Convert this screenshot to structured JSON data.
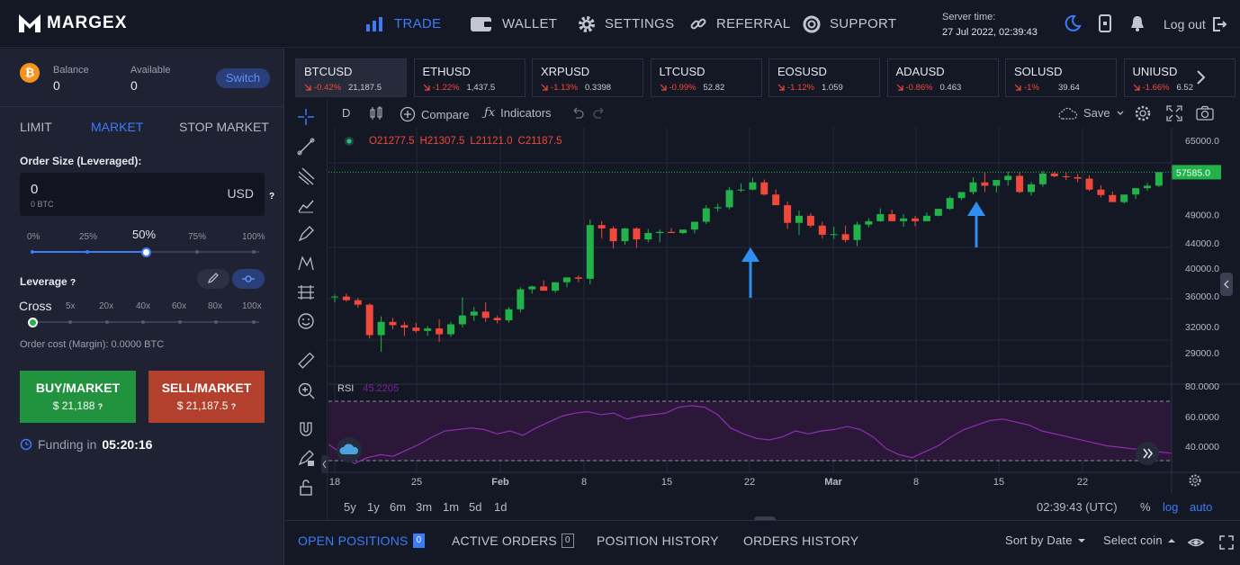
{
  "brand": {
    "name": "MARGEX"
  },
  "nav": {
    "trade": "TRADE",
    "wallet": "WALLET",
    "settings": "SETTINGS",
    "referral": "REFERRAL",
    "support": "SUPPORT"
  },
  "server": {
    "label": "Server time:",
    "time": "27 Jul 2022, 02:39:43"
  },
  "logout": "Log out",
  "account": {
    "coin_symbol": "₿",
    "balance_label": "Balance",
    "balance": "0",
    "available_label": "Available",
    "available": "0",
    "switch_label": "Switch"
  },
  "order_tabs": [
    "LIMIT",
    "MARKET",
    "STOP MARKET"
  ],
  "order_size": {
    "label": "Order Size (Leveraged):",
    "value": "0",
    "sub": "0 BTC",
    "currency": "USD",
    "help": "?"
  },
  "size_slider": {
    "ticks": [
      "0%",
      "25%",
      "50%",
      "75%",
      "100%"
    ],
    "value_pct": 50
  },
  "leverage": {
    "label": "Leverage",
    "help": "?",
    "mode": "Cross",
    "ticks": [
      "5x",
      "20x",
      "40x",
      "60x",
      "80x",
      "100x"
    ],
    "selected": "Cross"
  },
  "order_cost": "Order cost (Margin): 0.0000 BTC",
  "buy": {
    "label": "BUY/MARKET",
    "price": "$ 21,188",
    "help": "?"
  },
  "sell": {
    "label": "SELL/MARKET",
    "price": "$ 21,187.5",
    "help": "?"
  },
  "funding": {
    "label": "Funding in",
    "value": "05:20:16"
  },
  "tickers": [
    {
      "symbol": "BTCUSD",
      "change": "-0.42%",
      "price": "21,187.5"
    },
    {
      "symbol": "ETHUSD",
      "change": "-1.22%",
      "price": "1,437.5"
    },
    {
      "symbol": "XRPUSD",
      "change": "-1.13%",
      "price": "0.3398"
    },
    {
      "symbol": "LTCUSD",
      "change": "-0.99%",
      "price": "52.82"
    },
    {
      "symbol": "EOSUSD",
      "change": "-1.12%",
      "price": "1.059"
    },
    {
      "symbol": "ADAUSD",
      "change": "-0.86%",
      "price": "0.463"
    },
    {
      "symbol": "SOLUSD",
      "change": "-1%",
      "price": "39.64"
    },
    {
      "symbol": "UNIUSD",
      "change": "-1.66%",
      "price": "6.52"
    }
  ],
  "toolbar": {
    "interval": "D",
    "compare": "Compare",
    "indicators": "Indicators",
    "save": "Save"
  },
  "ohlc": {
    "o": "O21277.5",
    "h": "H21307.5",
    "l": "L21121.0",
    "c": "C21187.5"
  },
  "chart_data": {
    "type": "candlestick",
    "price_axis": [
      "65000.0",
      "57585.0",
      "49000.0",
      "44000.0",
      "40000.0",
      "36000.0",
      "32000.0",
      "29000.0"
    ],
    "current_price": "57585.0",
    "x_ticks": [
      "18",
      "25",
      "Feb",
      "8",
      "15",
      "22",
      "Mar",
      "8",
      "15",
      "22"
    ],
    "rsi_axis": [
      "80.0000",
      "60.0000",
      "40.0000"
    ],
    "rsi_label": "RSI",
    "rsi_value": "45.2205",
    "candles": [
      [
        35800,
        36200,
        35100,
        35900
      ],
      [
        35900,
        36300,
        35200,
        35400
      ],
      [
        35400,
        35700,
        34400,
        34800
      ],
      [
        34800,
        35000,
        30600,
        31000
      ],
      [
        31000,
        33300,
        29100,
        32600
      ],
      [
        32600,
        33100,
        31700,
        32200
      ],
      [
        32200,
        32600,
        30900,
        31900
      ],
      [
        31900,
        32500,
        31300,
        31500
      ],
      [
        31500,
        32100,
        30900,
        31800
      ],
      [
        31800,
        32900,
        30200,
        31100
      ],
      [
        31100,
        32600,
        30800,
        32300
      ],
      [
        32300,
        35800,
        31900,
        33400
      ],
      [
        33400,
        34500,
        32700,
        33900
      ],
      [
        33900,
        35100,
        32600,
        33100
      ],
      [
        33100,
        33400,
        32400,
        32800
      ],
      [
        32800,
        34500,
        32500,
        34200
      ],
      [
        34200,
        37200,
        33800,
        36900
      ],
      [
        36900,
        37400,
        36300,
        37300
      ],
      [
        37300,
        38200,
        36800,
        36700
      ],
      [
        36700,
        37900,
        36400,
        37900
      ],
      [
        37900,
        38600,
        37200,
        38600
      ],
      [
        38600,
        38900,
        37900,
        38400
      ],
      [
        38400,
        48100,
        37600,
        47100
      ],
      [
        47100,
        47800,
        44800,
        46500
      ],
      [
        46500,
        46900,
        43100,
        44300
      ],
      [
        44300,
        46600,
        43700,
        46500
      ],
      [
        46500,
        46700,
        43200,
        44600
      ],
      [
        44600,
        46400,
        44100,
        45700
      ],
      [
        45700,
        46300,
        44100,
        45900
      ],
      [
        45900,
        46600,
        45700,
        45700
      ],
      [
        45700,
        46300,
        45500,
        46300
      ],
      [
        46300,
        47300,
        45600,
        47700
      ],
      [
        47700,
        50800,
        47300,
        50200
      ],
      [
        50200,
        51100,
        49600,
        50400
      ],
      [
        50400,
        54400,
        50000,
        53800
      ],
      [
        53800,
        55200,
        53400,
        53900
      ],
      [
        53900,
        56400,
        53700,
        55400
      ],
      [
        55400,
        56000,
        52700,
        52900
      ],
      [
        52900,
        53900,
        50900,
        50800
      ],
      [
        50800,
        51500,
        46400,
        47500
      ],
      [
        47500,
        49800,
        45400,
        48800
      ],
      [
        48800,
        49300,
        46700,
        47000
      ],
      [
        47000,
        47700,
        44800,
        45400
      ],
      [
        45400,
        46800,
        44700,
        45500
      ],
      [
        45500,
        47000,
        44100,
        44500
      ],
      [
        44500,
        47700,
        43500,
        47200
      ],
      [
        47200,
        48300,
        46700,
        47800
      ],
      [
        47800,
        50200,
        47700,
        49100
      ],
      [
        49100,
        49900,
        47800,
        47800
      ],
      [
        47800,
        49100,
        46800,
        48300
      ],
      [
        48300,
        48800,
        46900,
        47800
      ],
      [
        47800,
        49400,
        47800,
        48800
      ],
      [
        48800,
        50000,
        48700,
        50100
      ],
      [
        50100,
        52600,
        49900,
        52200
      ],
      [
        52200,
        53300,
        51800,
        53400
      ],
      [
        53400,
        56500,
        52900,
        55400
      ],
      [
        55400,
        57500,
        53400,
        54700
      ],
      [
        54700,
        55700,
        53300,
        55900
      ],
      [
        55900,
        57700,
        54700,
        56800
      ],
      [
        56800,
        57700,
        53200,
        53400
      ],
      [
        53400,
        55500,
        52700,
        55000
      ],
      [
        55000,
        57900,
        54500,
        57300
      ],
      [
        57300,
        57700,
        56500,
        56700
      ],
      [
        56700,
        57600,
        55900,
        56500
      ],
      [
        56500,
        57200,
        55400,
        56200
      ],
      [
        56200,
        56900,
        53600,
        53900
      ],
      [
        53900,
        54800,
        52300,
        52800
      ],
      [
        52800,
        53500,
        51700,
        51400
      ],
      [
        51400,
        52400,
        51100,
        52900
      ],
      [
        52900,
        53800,
        52000,
        54200
      ],
      [
        54200,
        55300,
        53700,
        54700
      ],
      [
        54700,
        57600,
        54400,
        57585
      ]
    ]
  },
  "timeframes": {
    "ranges": [
      "5y",
      "1y",
      "6m",
      "3m",
      "1m",
      "5d",
      "1d"
    ],
    "clock": "02:39:43 (UTC)",
    "percent": "%",
    "log": "log",
    "auto": "auto"
  },
  "bottom_tabs": [
    {
      "label": "OPEN POSITIONS",
      "count": "0"
    },
    {
      "label": "ACTIVE ORDERS",
      "count": "0"
    },
    {
      "label": "POSITION HISTORY"
    },
    {
      "label": "ORDERS HISTORY"
    }
  ],
  "sort": {
    "label": "Sort by Date"
  },
  "select_coin": "Select coin",
  "colors": {
    "accent": "#3e7bf7",
    "up": "#21b24a",
    "down": "#f0483a",
    "buy": "#21923e",
    "sell": "#b2402c"
  }
}
